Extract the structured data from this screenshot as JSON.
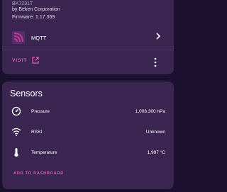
{
  "device": {
    "model": "BK7231T",
    "manufacturer": "by Beken Corporation",
    "firmware": "Firmware: 1.17.359",
    "integration_label": "MQTT",
    "visit_label": "VISIT"
  },
  "sensors": {
    "title": "Sensors",
    "items": [
      {
        "name": "Pressure",
        "value": "1,008.300 hPa",
        "icon": "gauge-icon"
      },
      {
        "name": "RSSI",
        "value": "Unknown",
        "icon": "wifi-icon"
      },
      {
        "name": "Temperature",
        "value": "1,997 °C",
        "icon": "thermometer-icon"
      }
    ],
    "add_label": "ADD TO DASHBOARD"
  },
  "colors": {
    "card": "#3a2650",
    "background": "#1b1030",
    "accent": "#e05fb0"
  }
}
